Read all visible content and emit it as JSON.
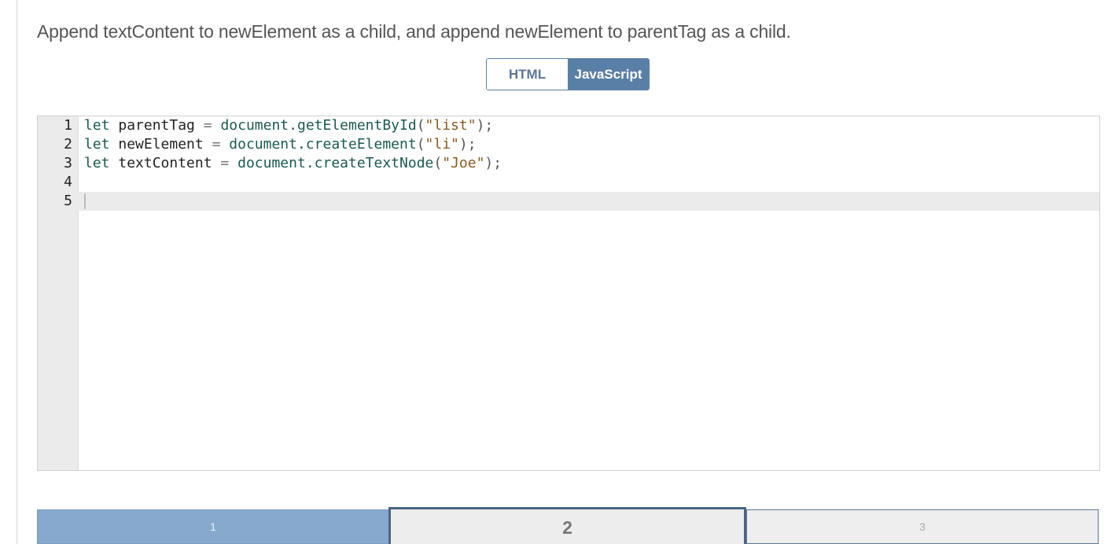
{
  "instruction": "Append textContent to newElement as a child, and append newElement to parentTag as a child.",
  "language_tabs": {
    "html_label": "HTML",
    "js_label": "JavaScript",
    "selected": "JavaScript"
  },
  "editor": {
    "active_line": 5,
    "line_numbers": [
      "1",
      "2",
      "3",
      "4",
      "5"
    ],
    "lines": [
      {
        "kw": "let",
        "name": "parentTag",
        "op": "=",
        "obj": "document",
        "method": ".getElementById",
        "open": "(",
        "str": "\"list\"",
        "close": ");"
      },
      {
        "kw": "let",
        "name": "newElement",
        "op": "=",
        "obj": "document",
        "method": ".createElement",
        "open": "(",
        "str": "\"li\"",
        "close": ");"
      },
      {
        "kw": "let",
        "name": "textContent",
        "op": "=",
        "obj": "document",
        "method": ".createTextNode",
        "open": "(",
        "str": "\"Joe\"",
        "close": ");"
      }
    ]
  },
  "pagination": {
    "pages": [
      "1",
      "2",
      "3"
    ],
    "current": "2"
  },
  "colors": {
    "accent": "#5a7fa6",
    "completed_page": "#87a9cd",
    "current_page_border": "#4c6582",
    "gutter": "#ebebeb"
  }
}
